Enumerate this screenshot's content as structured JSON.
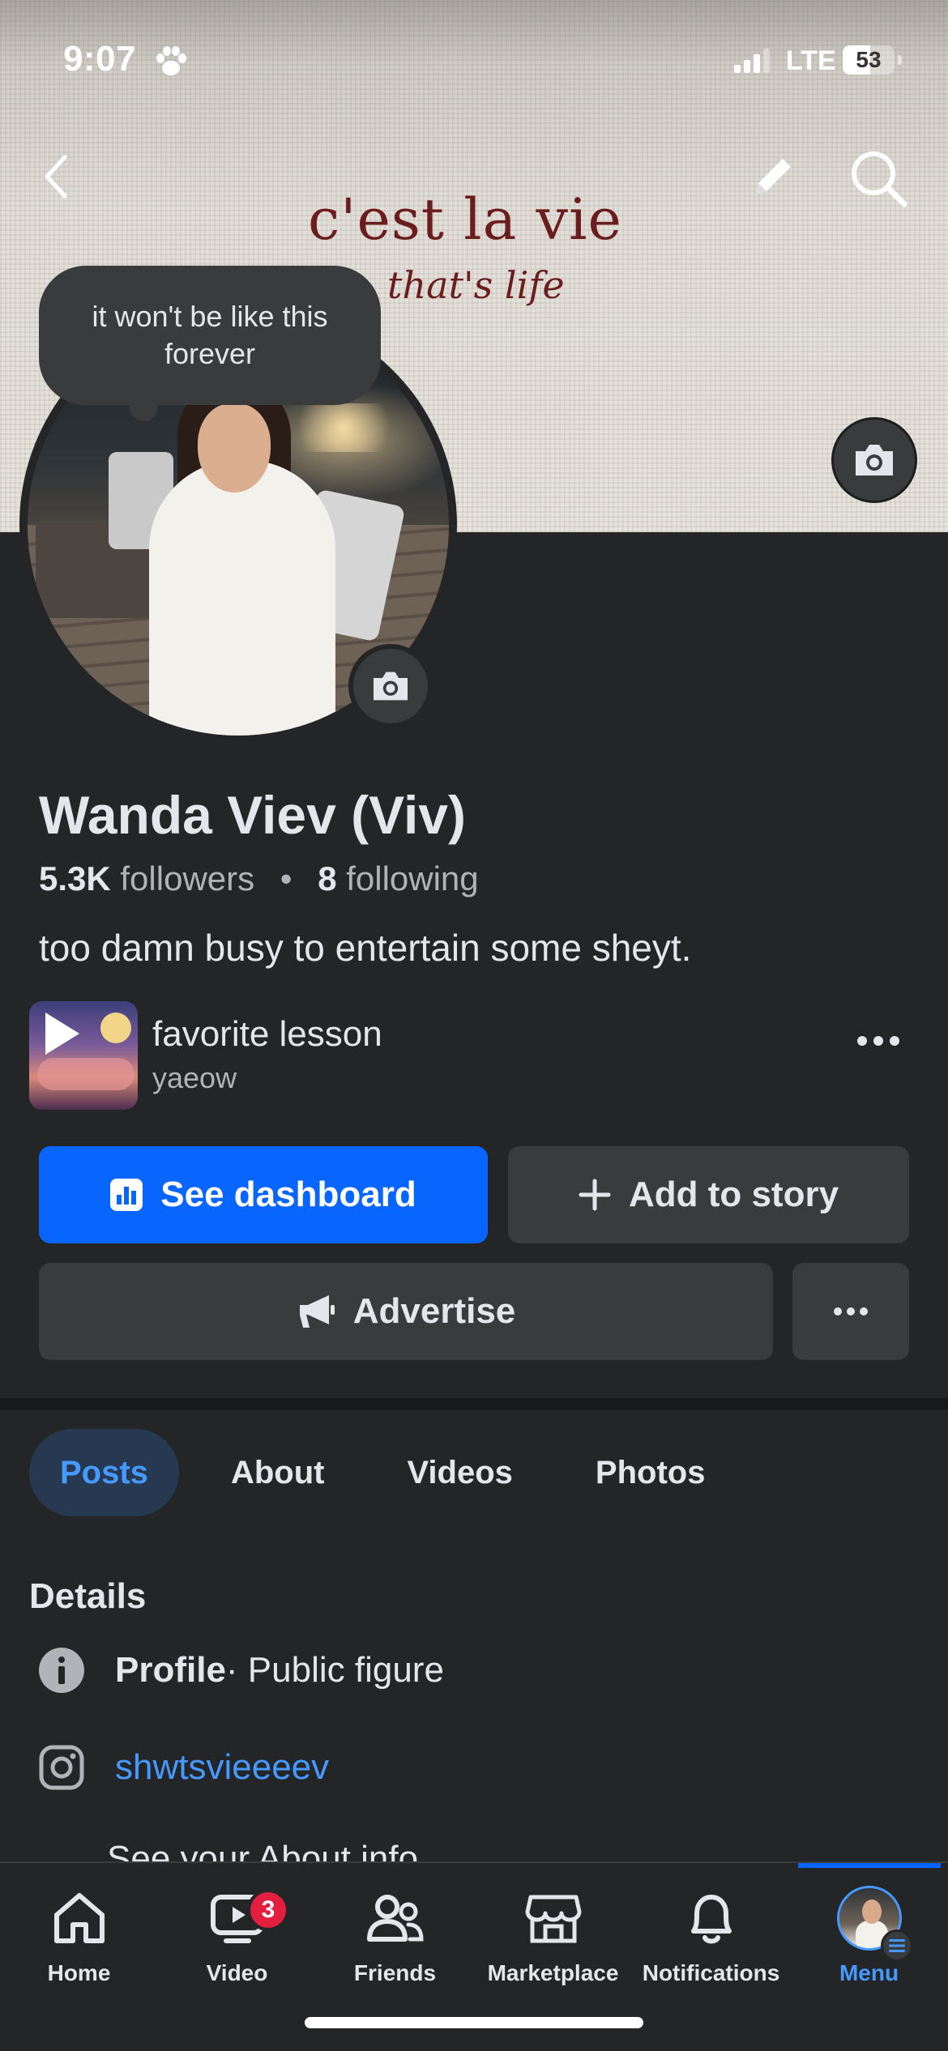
{
  "status_bar": {
    "time": "9:07",
    "network": "LTE",
    "battery": "53",
    "battery_level": 0.53
  },
  "cover": {
    "title": "c'est la vie",
    "subtitle": "that's life"
  },
  "note": {
    "text": "it won't be like this forever"
  },
  "profile": {
    "name": "Wanda Viev (Viv)",
    "followers_count": "5.3K",
    "followers_label": "followers",
    "separator": "•",
    "following_count": "8",
    "following_label": "following",
    "bio": "too damn busy to entertain some sheyt."
  },
  "music": {
    "title": "favorite lesson",
    "artist": "yaeow"
  },
  "actions": {
    "dashboard": "See dashboard",
    "add_story": "Add to story",
    "advertise": "Advertise"
  },
  "tabs": [
    {
      "label": "Posts",
      "active": true
    },
    {
      "label": "About",
      "active": false
    },
    {
      "label": "Videos",
      "active": false
    },
    {
      "label": "Photos",
      "active": false
    }
  ],
  "details": {
    "title": "Details",
    "profile_label": "Profile",
    "profile_value": " · Public figure",
    "instagram": "shwtsvieeeev",
    "see_about": "See your About info"
  },
  "bottom_nav": [
    {
      "label": "Home",
      "icon": "home-icon"
    },
    {
      "label": "Video",
      "icon": "video-icon",
      "badge": "3"
    },
    {
      "label": "Friends",
      "icon": "friends-icon"
    },
    {
      "label": "Marketplace",
      "icon": "marketplace-icon"
    },
    {
      "label": "Notifications",
      "icon": "bell-icon"
    },
    {
      "label": "Menu",
      "icon": "menu-avatar",
      "active": true
    }
  ],
  "colors": {
    "background": "#242526",
    "primary": "#0866ff",
    "accent_text": "#4599ff",
    "surface": "#3a3b3c",
    "badge": "#e41e3f"
  }
}
